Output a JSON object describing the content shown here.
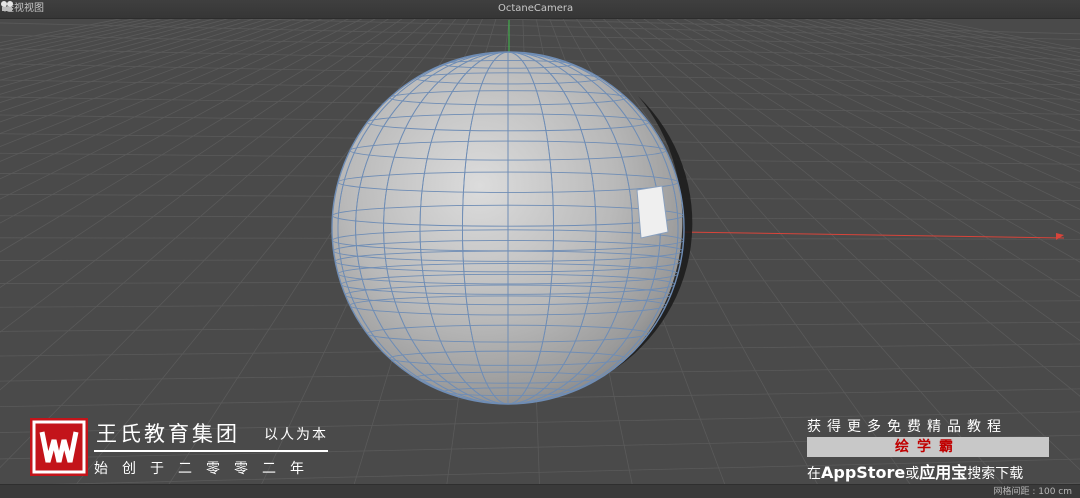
{
  "viewport": {
    "view_name": "透视视图",
    "camera_name": "OctaneCamera",
    "grid_spacing": "网格间距 : 100 cm",
    "object": "sphere-mesh"
  },
  "watermark_left": {
    "company": "王氏教育集团",
    "motto": "以人为本",
    "since": "始创于二零零二年"
  },
  "watermark_right": {
    "title": "获得更多免费精品教程",
    "app_name": "绘学霸",
    "line_prefix": "在",
    "store_1": "AppStore",
    "line_or": "或",
    "store_2": "应用宝",
    "line_suffix": "搜索下载"
  },
  "colors": {
    "background": "#4a4a4a",
    "grid": "#5a5a5a",
    "axis_x": "#d8443a",
    "axis_y": "#3fbf4a",
    "wireframe": "#6f8db5",
    "brand_red": "#c3141a"
  },
  "icons": [
    "camera-icon",
    "wang-logo-icon"
  ]
}
